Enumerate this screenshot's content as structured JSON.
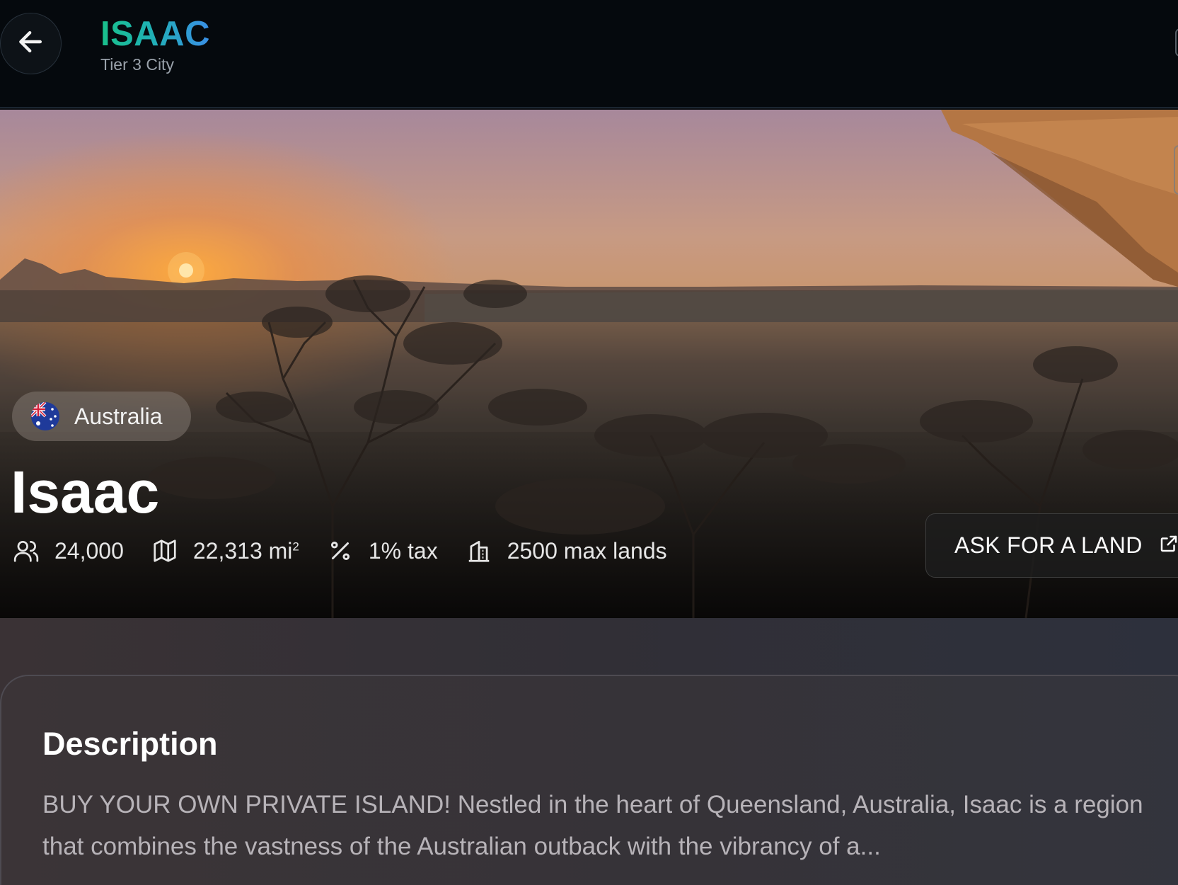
{
  "header": {
    "back_icon": "arrow-left-icon",
    "title": "ISAAC",
    "subtitle": "Tier 3 City"
  },
  "hero": {
    "country": "Australia",
    "flag_icon": "australia-flag-icon",
    "city_name": "Isaac",
    "stats": {
      "population": "24,000",
      "area_value": "22,313 mi",
      "area_unit_sup": "2",
      "tax": "1% tax",
      "max_lands": "2500 max lands"
    },
    "ask_button_label": "ASK FOR A LAND",
    "ask_button_icon": "external-link-icon"
  },
  "description": {
    "title": "Description",
    "text": "BUY YOUR OWN PRIVATE ISLAND! Nestled in the heart of Queensland, Australia, Isaac is a region that combines the vastness of the Australian outback with the vibrancy of a..."
  },
  "colors": {
    "title_gradient_start": "#19c08a",
    "title_gradient_end": "#3a8fe6",
    "topbar_bg": "#05090d"
  }
}
